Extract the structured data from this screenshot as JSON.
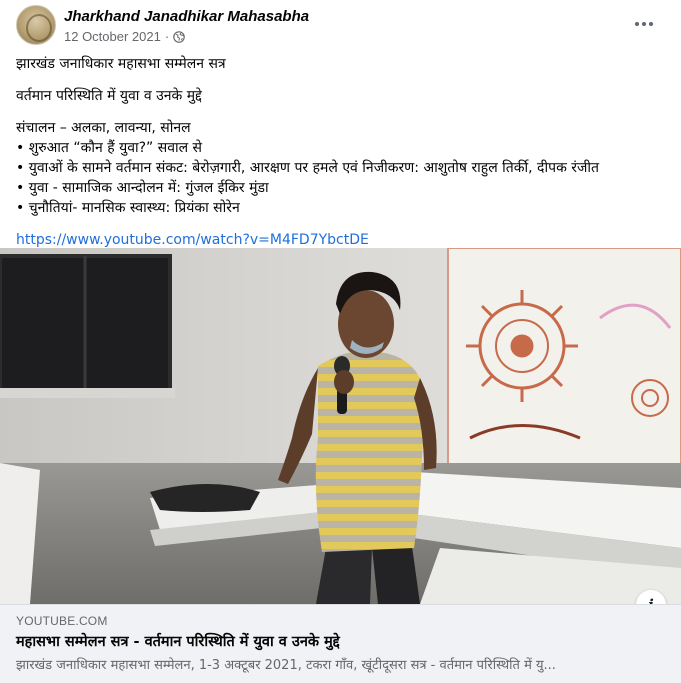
{
  "header": {
    "page_name": "Jharkhand Janadhikar Mahasabha",
    "date": "12 October 2021",
    "separator": "·",
    "privacy_icon": "globe-icon",
    "more_icon": "more-options-icon"
  },
  "post": {
    "lines": [
      "झारखंड जनाधिकार महासभा सम्मेलन सत्र",
      "वर्तमान परिस्थिति में युवा व उनके मुद्दे",
      "संचालन – अलका, लावन्या, सोनल",
      "• शुरुआत “कौन हैं युवा?” सवाल से",
      "• युवाओं के सामने वर्तमान संकट: बेरोज़गारी, आरक्षण पर हमले एवं निजीकरण: आशुतोष राहुल तिर्की, दीपक रंजीत",
      "• युवा - सामाजिक आन्दोलन में: गुंजल ईकिर मुंडा",
      "• चुनौतियां- मानसिक स्वास्थ्य: प्रियंका सोरेन"
    ],
    "link": "https://www.youtube.com/watch?v=M4FD7YbctDE"
  },
  "media": {
    "info_icon": "info-icon",
    "info_label": "i"
  },
  "preview": {
    "domain": "YOUTUBE.COM",
    "title": "महासभा सम्मेलन सत्र - वर्तमान परिस्थिति में युवा व उनके मुद्दे",
    "description": "झारखंड जनाधिकार महासभा सम्मेलन, 1-3 अक्टूबर 2021, टकरा गाँव, खूंटीदूसरा सत्र - वर्तमान परिस्थिति में यु..."
  },
  "colors": {
    "link": "#216fdb",
    "muted": "#65676b",
    "preview_bg": "#f0f2f5",
    "stripe_yellow": "#e3c95a",
    "stripe_grey": "#b9b4a6"
  }
}
